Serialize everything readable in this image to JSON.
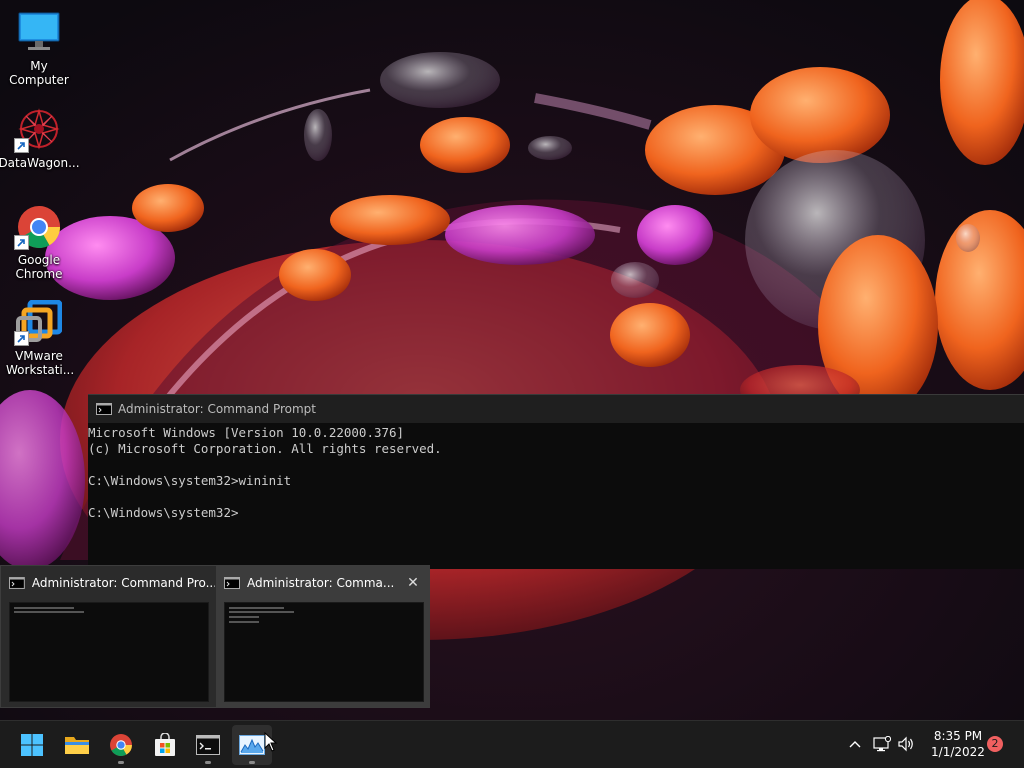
{
  "desktop": {
    "icons": [
      {
        "label": "My Computer",
        "icon": "computer-icon"
      },
      {
        "label": "DataWagon...",
        "icon": "datawagon-icon"
      },
      {
        "label": "Google Chrome",
        "icon": "chrome-icon"
      },
      {
        "label": "VMware Workstati...",
        "icon": "vmware-icon"
      }
    ]
  },
  "cmd_window": {
    "title": "Administrator: Command Prompt",
    "lines": [
      "Microsoft Windows [Version 10.0.22000.376]",
      "(c) Microsoft Corporation. All rights reserved.",
      "",
      "C:\\Windows\\system32>wininit",
      "",
      "C:\\Windows\\system32>"
    ]
  },
  "thumbnails": [
    {
      "title": "Administrator: Command Pro..."
    },
    {
      "title": "Administrator: Comma..."
    }
  ],
  "taskbar": {
    "apps": [
      {
        "name": "start",
        "icon": "windows-start-icon",
        "open": false
      },
      {
        "name": "file-explorer",
        "icon": "folder-icon",
        "open": false
      },
      {
        "name": "chrome",
        "icon": "chrome-icon",
        "open": true
      },
      {
        "name": "store",
        "icon": "store-icon",
        "open": false
      },
      {
        "name": "command-prompt",
        "icon": "terminal-icon",
        "open": true
      },
      {
        "name": "resource-monitor",
        "icon": "monitor-graph-icon",
        "open": true
      }
    ],
    "tray": {
      "time": "8:35 PM",
      "date": "1/1/2022",
      "notifications": "2"
    }
  },
  "colors": {
    "taskbar_bg": "#1c1c1c",
    "terminal_bg": "#0c0c0c",
    "terminal_text": "#cccccc",
    "badge": "#f06060"
  }
}
